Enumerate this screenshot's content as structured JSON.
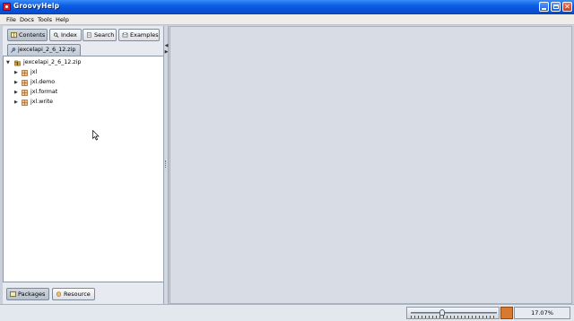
{
  "window": {
    "title": "GroovyHelp"
  },
  "menu": [
    "File",
    "Docs",
    "Tools",
    "Help"
  ],
  "left": {
    "tabs": [
      {
        "label": "Contents",
        "icon": "book-icon"
      },
      {
        "label": "Index",
        "icon": "magnifier-icon"
      },
      {
        "label": "Search",
        "icon": "document-search-icon"
      },
      {
        "label": "Examples",
        "icon": "examples-icon"
      }
    ],
    "active_tab": "Contents",
    "file_tab": "jexcelapi_2_6_12.zip",
    "tree": {
      "root": "jexcelapi_2_6_12.zip",
      "children": [
        "jxl",
        "jxl.demo",
        "jxl.format",
        "jxl.write"
      ]
    },
    "bottom_tabs": [
      {
        "label": "Packages",
        "icon": "packages-icon"
      },
      {
        "label": "Resource",
        "icon": "resource-icon"
      }
    ]
  },
  "status": {
    "zoom_value": "17.07%",
    "zoom_fraction": 0.36
  },
  "colors": {
    "titlebar": "#0b5fe6",
    "zoom_indicator": "#d9792e",
    "tree_bg": "#ffffff"
  }
}
